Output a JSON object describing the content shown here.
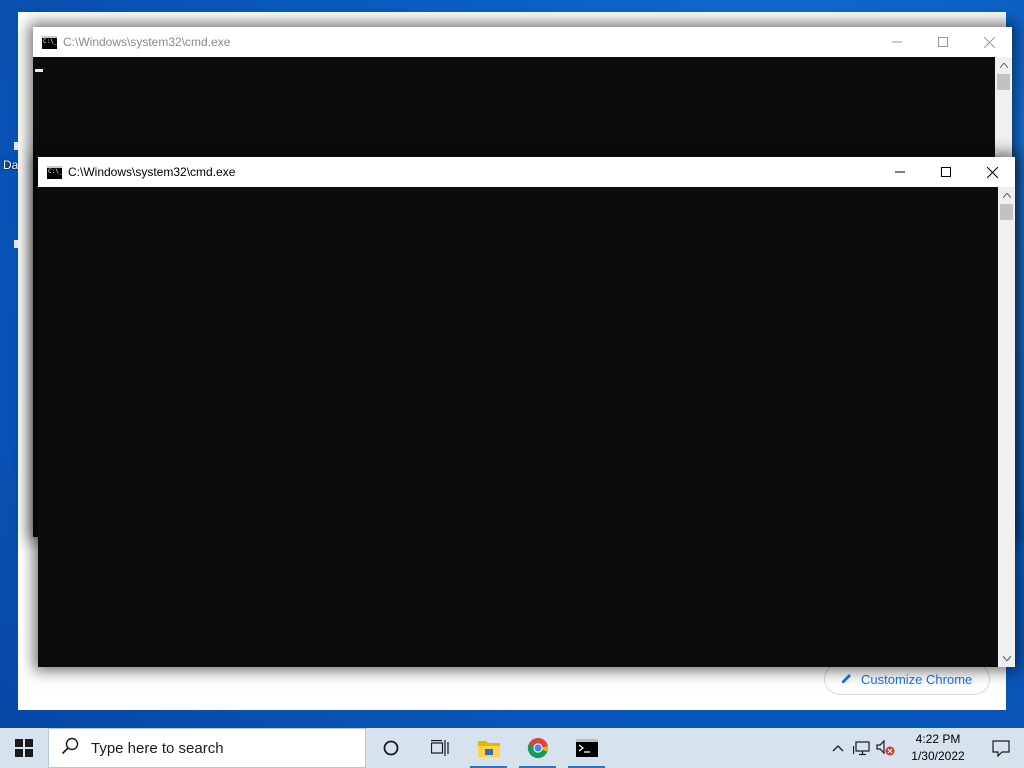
{
  "desktop": {
    "partial_icon_label": "Da"
  },
  "browser": {
    "customize_button_label": "Customize Chrome"
  },
  "windows": [
    {
      "title": "C:\\Windows\\system32\\cmd.exe",
      "state": "inactive"
    },
    {
      "title": "C:\\Windows\\system32\\cmd.exe",
      "state": "active"
    }
  ],
  "taskbar": {
    "search_placeholder": "Type here to search",
    "pinned": [
      "task-view",
      "file-explorer",
      "chrome",
      "command-prompt"
    ],
    "clock": {
      "time": "4:22 PM",
      "date": "1/30/2022"
    }
  },
  "colors": {
    "console_bg": "#0c0c0c",
    "titlebar_bg": "#ffffff",
    "taskbar_bg": "#d7e2ef",
    "accent": "#1a73e8",
    "desktop_blue": "#0a5fc4"
  }
}
